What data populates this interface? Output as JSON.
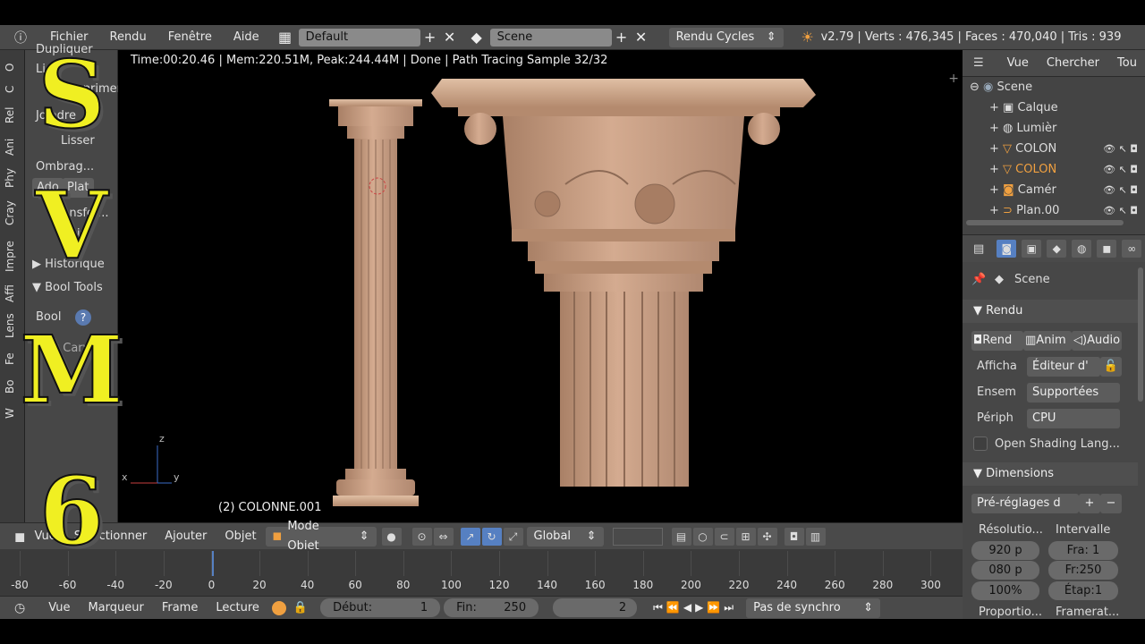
{
  "topbar": {
    "menus": [
      "Fichier",
      "Rendu",
      "Fenêtre",
      "Aide"
    ],
    "screen_layout": "Default",
    "scene": "Scene",
    "engine": "Rendu Cycles",
    "stats": "v2.79 | Verts : 476,345 | Faces : 470,040 | Tris : 939"
  },
  "tabs": [
    "O",
    "C",
    "Rel",
    "Ani",
    "Phy",
    "Cray",
    "Impre",
    "Affi",
    "Lens",
    "Fe",
    "Bo",
    "W"
  ],
  "toolpanel": {
    "dupliquer": "Dupliquer",
    "lier": "Lier",
    "supprimer": "Supprimer",
    "joindre": "Joindre",
    "lisser": "Lisser",
    "ombrage": "Ombrag...",
    "ado": "Ado",
    "plat": "Plat",
    "transfer": "Transfer...",
    "dis": "Dis",
    "historique": "Historique",
    "booltools": "Bool Tools",
    "bool": "Bool",
    "fast_carve": "Fast Carve"
  },
  "viewport": {
    "status": "Time:00:20.46 | Mem:220.51M, Peak:244.44M | Done | Path Tracing Sample 32/32",
    "object_name": "(2) COLONNE.001",
    "axes": {
      "z": "z",
      "x": "x",
      "y": "y"
    }
  },
  "view3d_header": {
    "vue": "Vue",
    "selectionner": "Sélectionner",
    "ajouter": "Ajouter",
    "objet": "Objet",
    "mode": "Mode Objet",
    "orientation": "Global"
  },
  "timeline": {
    "ticks": [
      "-80",
      "-60",
      "-40",
      "-20",
      "0",
      "20",
      "40",
      "60",
      "80",
      "100",
      "120",
      "140",
      "160",
      "180",
      "200",
      "220",
      "240",
      "260",
      "280",
      "300"
    ],
    "current_frame_marker": 2
  },
  "timeline_header": {
    "vue": "Vue",
    "marqueur": "Marqueur",
    "frame": "Frame",
    "lecture": "Lecture",
    "debut_label": "Début:",
    "debut": "1",
    "fin_label": "Fin:",
    "fin": "250",
    "current": "2",
    "sync": "Pas de synchro"
  },
  "outliner": {
    "vue": "Vue",
    "chercher": "Chercher",
    "tous": "Tou",
    "items": [
      "Scene",
      "Calque",
      "Lumièr",
      "COLON",
      "COLON",
      "Camér",
      "Plan.00"
    ]
  },
  "properties": {
    "scene": "Scene",
    "rendu_section": "Rendu",
    "rendu_btn": "Rend",
    "anim_btn": "Anim",
    "audio_btn": "Audio",
    "affichage_label": "Afficha",
    "affichage_value": "Éditeur d'",
    "ensemble_label": "Ensem",
    "ensemble_value": "Supportées",
    "peripherique_label": "Périph",
    "peripherique_value": "CPU",
    "osl": "Open Shading Lang...",
    "dimensions_section": "Dimensions",
    "presets": "Pré-réglages d",
    "resolution_label": "Résolutio...",
    "intervalle_label": "Intervalle",
    "res_x": "920 p",
    "res_y": "080 p",
    "res_pct": "100%",
    "fra": "Fra:  1",
    "fr_end": "Fr:250",
    "etape": "Étap:1",
    "proportions": "Proportio...",
    "framerate": "Framerat..."
  },
  "overlay": [
    "S",
    "V",
    "M",
    "6"
  ],
  "colors": {
    "overlay_yellow": "#f0ef22",
    "accent_blue": "#5680c2",
    "selected_orange": "#f0a040",
    "stone": "#c9a083"
  }
}
